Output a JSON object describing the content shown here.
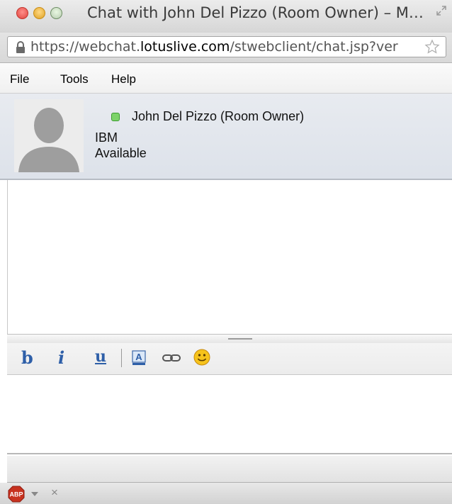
{
  "window": {
    "title": "Chat with John Del Pizzo (Room Owner) – M…",
    "url_prefix": "https://webchat.",
    "url_domain": "lotuslive.com",
    "url_suffix": "/stwebclient/chat.jsp?ver"
  },
  "menu": {
    "file": "File",
    "tools": "Tools",
    "help": "Help"
  },
  "contact": {
    "name": "John Del Pizzo (Room Owner)",
    "company": "IBM",
    "status": "Available",
    "status_color": "#7dd36a"
  },
  "toolbar": {
    "bold": "b",
    "italic": "i",
    "underline": "u",
    "font_glyph": "A"
  },
  "input": {
    "value": ""
  },
  "addon": {
    "abp": "ABP",
    "close": "×"
  }
}
